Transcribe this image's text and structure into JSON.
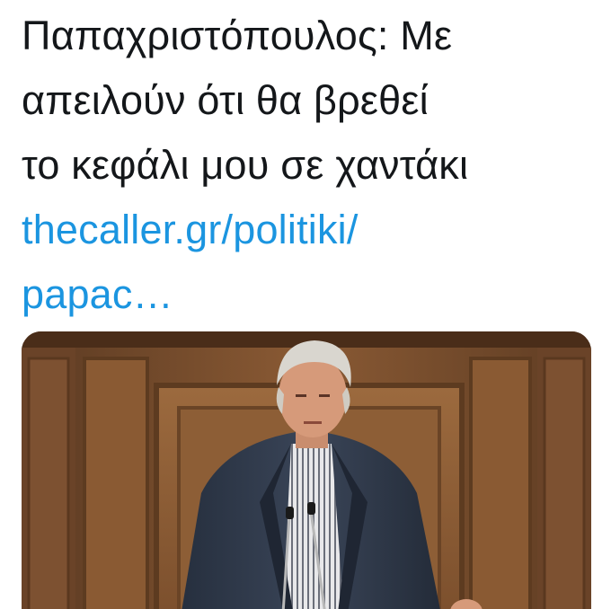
{
  "tweet": {
    "text_lines": [
      "Παπαχριστόπουλος: Με",
      "απειλούν ότι θα βρεθεί",
      "το κεφάλι μου σε χαντάκι"
    ],
    "link_lines": [
      "thecaller.gr/politiki/",
      "papac…"
    ]
  },
  "media": {
    "icon": "photo-speaker-at-podium"
  },
  "colors": {
    "text": "#14171a",
    "link": "#1b95e0",
    "background": "#ffffff"
  }
}
